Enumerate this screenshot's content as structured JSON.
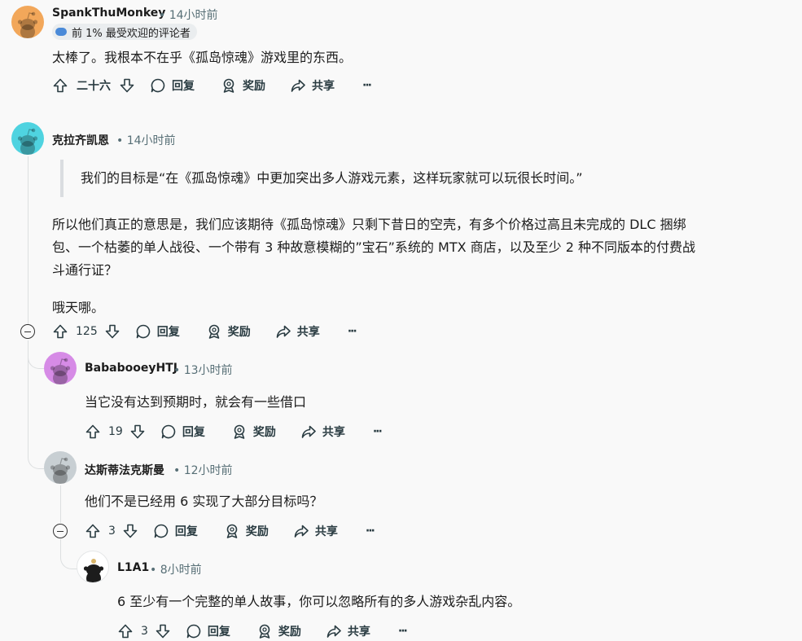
{
  "comments": [
    {
      "author": "SpankThuMonkey",
      "time": "14小时前",
      "flair": "前 1% 最受欢迎的评论者",
      "body": [
        "太棒了。我根本不在乎《孤岛惊魂》游戏里的东西。"
      ],
      "votes": "二十六",
      "avatar_color": "#f2a75a"
    },
    {
      "author": "克拉齐凯恩",
      "time": "14小时前",
      "quote": "我们的目标是“在《孤岛惊魂》中更加突出多人游戏元素，这样玩家就可以玩很长时间。”",
      "body": [
        "所以他们真正的意思是，我们应该期待《孤岛惊魂》只剩下昔日的空壳，有多个价格过高且未完成的 DLC 捆绑",
        "包、一个枯萎的单人战役、一个带有 3 种故意模糊的”宝石”系统的 MTX 商店，以及至少 2 种不同版本的付费战",
        "斗通行证？",
        "哦天哪。"
      ],
      "votes": "125",
      "avatar_color": "#4fd3e0"
    },
    {
      "author": "BababooeyHTJ",
      "time": "13小时前",
      "body": [
        "当它没有达到预期时，就会有一些借口"
      ],
      "votes": "19",
      "avatar_color": "#d68be6"
    },
    {
      "author": "达斯蒂法克斯曼",
      "time": "12小时前",
      "body": [
        "他们不是已经用 6 实现了大部分目标吗？"
      ],
      "votes": "3",
      "avatar_color": "#c8cfd3"
    },
    {
      "author": "L1A1",
      "time": "8小时前",
      "body": [
        "6 至少有一个完整的单人故事，你可以忽略所有的多人游戏杂乱内容。"
      ],
      "votes": "3",
      "avatar_color": "#ffffff"
    }
  ],
  "labels": {
    "reply": "回复",
    "award": "奖励",
    "share": "共享",
    "more": "···",
    "dot": "•"
  },
  "icons": [
    "upvote-icon",
    "downvote-icon",
    "comment-icon",
    "award-icon",
    "share-icon",
    "more-icon",
    "collapse-icon",
    "snoo-avatar-icon"
  ]
}
